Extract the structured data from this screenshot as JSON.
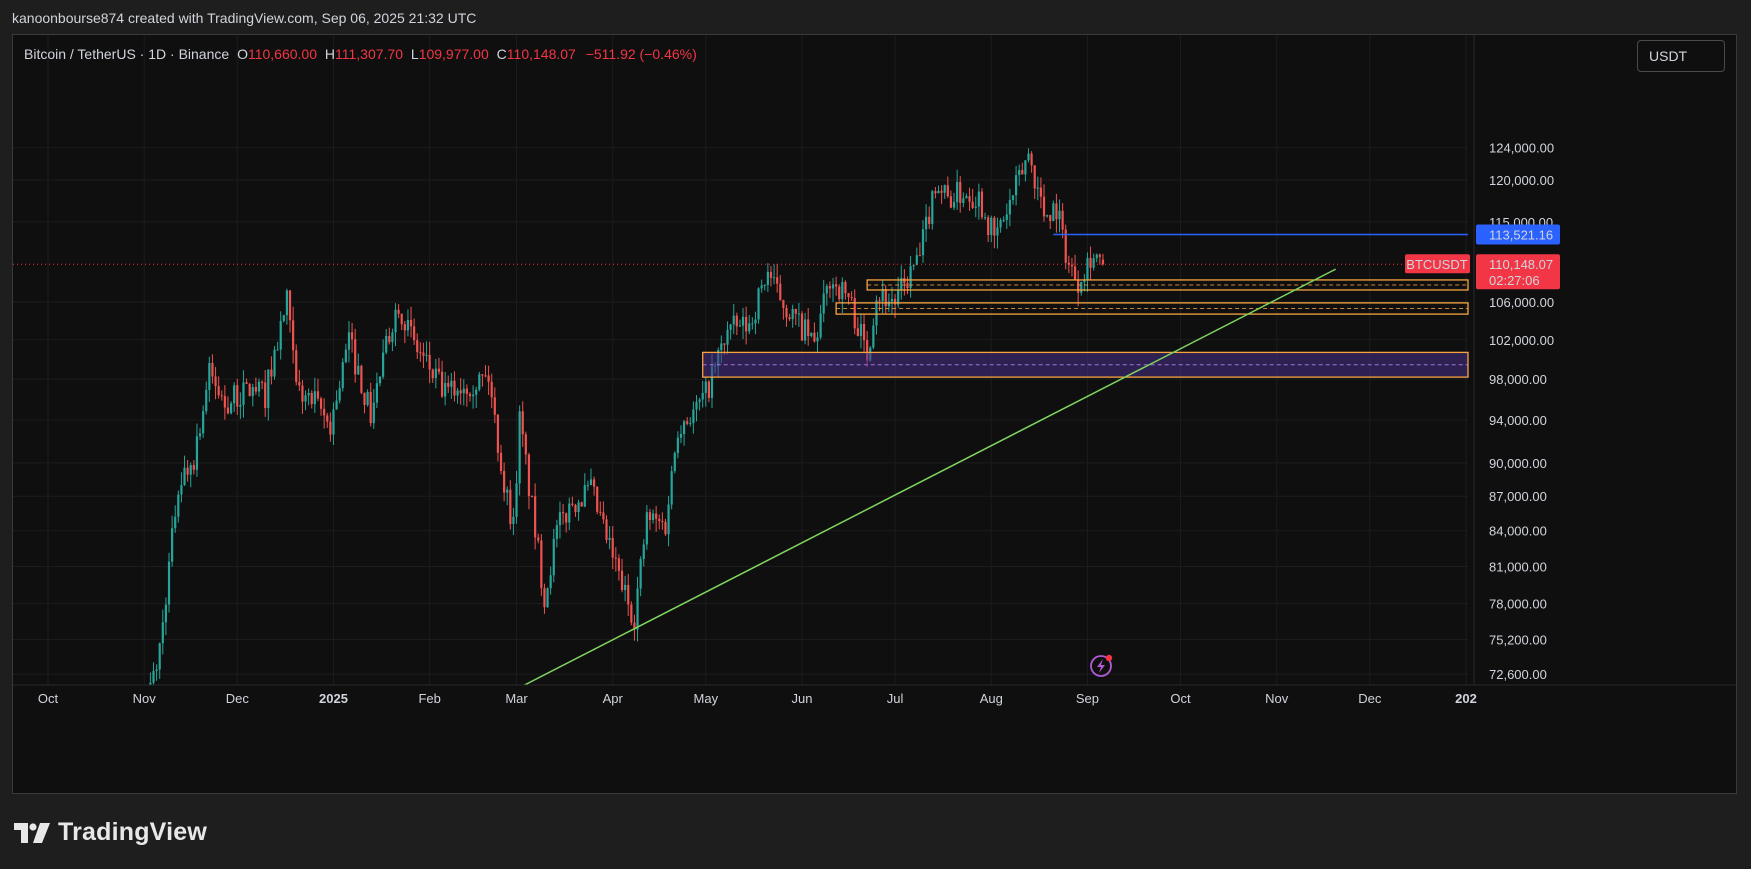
{
  "header": {
    "attribution": "kanoonbourse874 created with TradingView.com, Sep 06, 2025 21:32 UTC"
  },
  "legend": {
    "symbol_text": "Bitcoin / TetherUS · 1D · Binance",
    "open_key": "O",
    "open": "110,660.00",
    "high_key": "H",
    "high": "111,307.70",
    "low_key": "L",
    "low": "109,977.00",
    "close_key": "C",
    "close": "110,148.07",
    "change": "−511.92 (−0.46%)"
  },
  "currency_button": "USDT",
  "footer": {
    "brand": "TradingView"
  },
  "colors": {
    "background": "#0f0f0f",
    "up": "#26a69a",
    "down": "#ef5350",
    "hline_blue": "#2962ff",
    "trendline": "#7fd45f",
    "zone_border": "#f7a440",
    "zone_fill": "#4a2f8a",
    "price_label": "#f23645"
  },
  "chart_data": {
    "type": "candlestick",
    "symbol": "BTCUSDT",
    "timeframe": "1D",
    "exchange": "Binance",
    "y_scale": "log",
    "ylim": [
      71800,
      131500
    ],
    "grid": true,
    "y_ticks": [
      {
        "value": 124000,
        "label": "124,000.00"
      },
      {
        "value": 120000,
        "label": "120,000.00"
      },
      {
        "value": 115000,
        "label": "115,000.00"
      },
      {
        "value": 106000,
        "label": "106,000.00"
      },
      {
        "value": 102000,
        "label": "102,000.00"
      },
      {
        "value": 98000,
        "label": "98,000.00"
      },
      {
        "value": 94000,
        "label": "94,000.00"
      },
      {
        "value": 90000,
        "label": "90,000.00"
      },
      {
        "value": 87000,
        "label": "87,000.00"
      },
      {
        "value": 84000,
        "label": "84,000.00"
      },
      {
        "value": 81000,
        "label": "81,000.00"
      },
      {
        "value": 78000,
        "label": "78,000.00"
      },
      {
        "value": 75200,
        "label": "75,200.00"
      },
      {
        "value": 72600,
        "label": "72,600.00"
      }
    ],
    "x_ticks": [
      {
        "date": "2024-10-01",
        "label": "Oct",
        "bold": false
      },
      {
        "date": "2024-11-01",
        "label": "Nov",
        "bold": false
      },
      {
        "date": "2024-12-01",
        "label": "Dec",
        "bold": false
      },
      {
        "date": "2025-01-01",
        "label": "2025",
        "bold": true
      },
      {
        "date": "2025-02-01",
        "label": "Feb",
        "bold": false
      },
      {
        "date": "2025-03-01",
        "label": "Mar",
        "bold": false
      },
      {
        "date": "2025-04-01",
        "label": "Apr",
        "bold": false
      },
      {
        "date": "2025-05-01",
        "label": "May",
        "bold": false
      },
      {
        "date": "2025-06-01",
        "label": "Jun",
        "bold": false
      },
      {
        "date": "2025-07-01",
        "label": "Jul",
        "bold": false
      },
      {
        "date": "2025-08-01",
        "label": "Aug",
        "bold": false
      },
      {
        "date": "2025-09-01",
        "label": "Sep",
        "bold": false
      },
      {
        "date": "2025-10-01",
        "label": "Oct",
        "bold": false
      },
      {
        "date": "2025-11-01",
        "label": "Nov",
        "bold": false
      },
      {
        "date": "2025-12-01",
        "label": "Dec",
        "bold": false
      },
      {
        "date": "2026-01-01",
        "label": "202",
        "bold": true
      }
    ],
    "anchors": [
      [
        "2024-11-01",
        69500
      ],
      [
        "2024-11-06",
        74500
      ],
      [
        "2024-11-12",
        88000
      ],
      [
        "2024-11-17",
        90500
      ],
      [
        "2024-11-22",
        98500
      ],
      [
        "2024-11-27",
        95500
      ],
      [
        "2024-12-05",
        97000
      ],
      [
        "2024-12-10",
        96500
      ],
      [
        "2024-12-17",
        106000
      ],
      [
        "2024-12-20",
        97000
      ],
      [
        "2024-12-26",
        95500
      ],
      [
        "2024-12-31",
        93500
      ],
      [
        "2025-01-06",
        102000
      ],
      [
        "2025-01-13",
        94500
      ],
      [
        "2025-01-20",
        104000
      ],
      [
        "2025-01-22",
        106000
      ],
      [
        "2025-01-27",
        101500
      ],
      [
        "2025-02-03",
        98000
      ],
      [
        "2025-02-06",
        96500
      ],
      [
        "2025-02-12",
        97500
      ],
      [
        "2025-02-20",
        98200
      ],
      [
        "2025-02-25",
        88000
      ],
      [
        "2025-02-28",
        84500
      ],
      [
        "2025-03-02",
        94000
      ],
      [
        "2025-03-10",
        78500
      ],
      [
        "2025-03-14",
        84000
      ],
      [
        "2025-03-19",
        86500
      ],
      [
        "2025-03-25",
        87500
      ],
      [
        "2025-03-31",
        82500
      ],
      [
        "2025-04-06",
        78000
      ],
      [
        "2025-04-08",
        77000
      ],
      [
        "2025-04-12",
        85000
      ],
      [
        "2025-04-18",
        84500
      ],
      [
        "2025-04-22",
        93500
      ],
      [
        "2025-04-28",
        95000
      ],
      [
        "2025-05-01",
        96500
      ],
      [
        "2025-05-08",
        103000
      ],
      [
        "2025-05-15",
        103500
      ],
      [
        "2025-05-21",
        109500
      ],
      [
        "2025-05-23",
        107500
      ],
      [
        "2025-05-30",
        104000
      ],
      [
        "2025-06-05",
        101500
      ],
      [
        "2025-06-10",
        108500
      ],
      [
        "2025-06-16",
        106500
      ],
      [
        "2025-06-22",
        100500
      ],
      [
        "2025-06-25",
        107000
      ],
      [
        "2025-07-01",
        106000
      ],
      [
        "2025-07-09",
        111000
      ],
      [
        "2025-07-14",
        119800
      ],
      [
        "2025-07-18",
        117800
      ],
      [
        "2025-07-23",
        118500
      ],
      [
        "2025-07-28",
        118000
      ],
      [
        "2025-08-02",
        113000
      ],
      [
        "2025-08-07",
        117000
      ],
      [
        "2025-08-13",
        123300
      ],
      [
        "2025-08-18",
        116000
      ],
      [
        "2025-08-22",
        116800
      ],
      [
        "2025-08-26",
        110000
      ],
      [
        "2025-08-29",
        108400
      ],
      [
        "2025-09-02",
        111200
      ],
      [
        "2025-09-04",
        110800
      ],
      [
        "2025-09-06",
        110148.07
      ]
    ],
    "last_candle": {
      "date": "2025-09-06",
      "open": 110660.0,
      "high": 111307.7,
      "low": 109977.0,
      "close": 110148.07
    },
    "horizontal_line": {
      "price": 113521.16,
      "label": "113,521.16",
      "start": "2025-08-21",
      "color": "#2962ff"
    },
    "current_price": {
      "price": 110148.07,
      "symbol_label": "BTCUSDT",
      "price_label": "110,148.07",
      "countdown": "02:27:06"
    },
    "trendline": {
      "p1": [
        "2025-03-01",
        71500
      ],
      "p2": [
        "2025-11-20",
        109600
      ],
      "color": "#7fd45f"
    },
    "zones": [
      {
        "start": "2025-06-22",
        "top": 108400,
        "bottom": 107300,
        "style": "outline"
      },
      {
        "start": "2025-06-12",
        "top": 105900,
        "bottom": 104700,
        "style": "outline"
      },
      {
        "start": "2025-04-30",
        "top": 100700,
        "bottom": 98200,
        "style": "filled"
      }
    ]
  }
}
